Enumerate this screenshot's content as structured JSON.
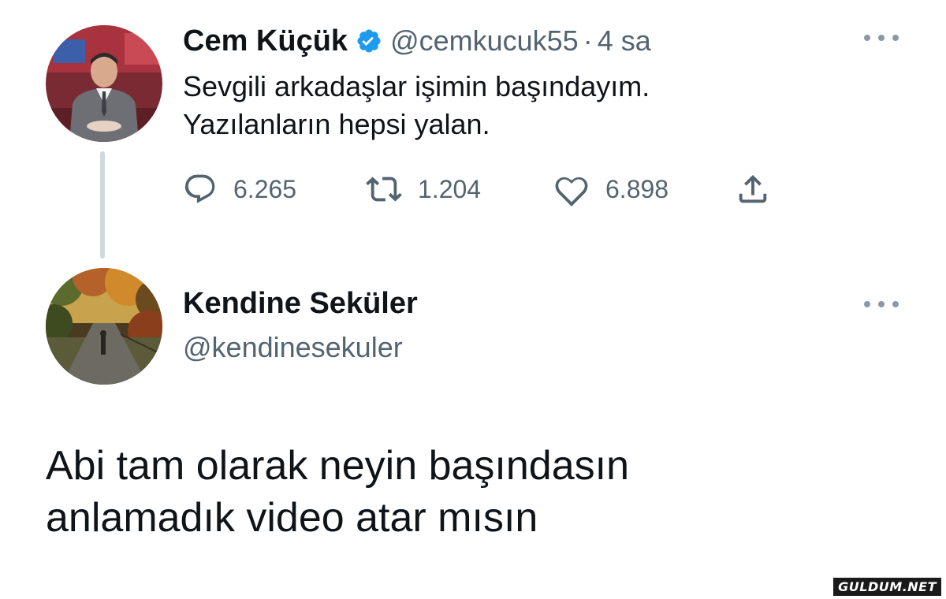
{
  "tweet1": {
    "author_name": "Cem Küçük",
    "handle": "@cemkucuk55",
    "separator": "·",
    "time": "4 sa",
    "verified": true,
    "text_lines": [
      "Sevgili arkadaşlar işimin başındayım.",
      "Yazılanların hepsi yalan."
    ],
    "actions": {
      "replies": "6.265",
      "retweets": "1.204",
      "likes": "6.898"
    }
  },
  "tweet2": {
    "author_name": "Kendine Seküler",
    "handle": "@kendinesekuler",
    "text_lines": [
      "Abi tam olarak neyin başındasın",
      "anlamadık video atar mısın"
    ]
  },
  "watermark": "GULDUM.NET",
  "colors": {
    "text": "#0f1419",
    "secondary": "#536471",
    "verified": "#1d9bf0",
    "thread_line": "#cfd9de"
  },
  "icons": {
    "reply": "reply-icon",
    "retweet": "retweet-icon",
    "like": "heart-icon",
    "share": "share-icon",
    "more": "more-dots-icon",
    "verified": "verified-badge-icon"
  }
}
